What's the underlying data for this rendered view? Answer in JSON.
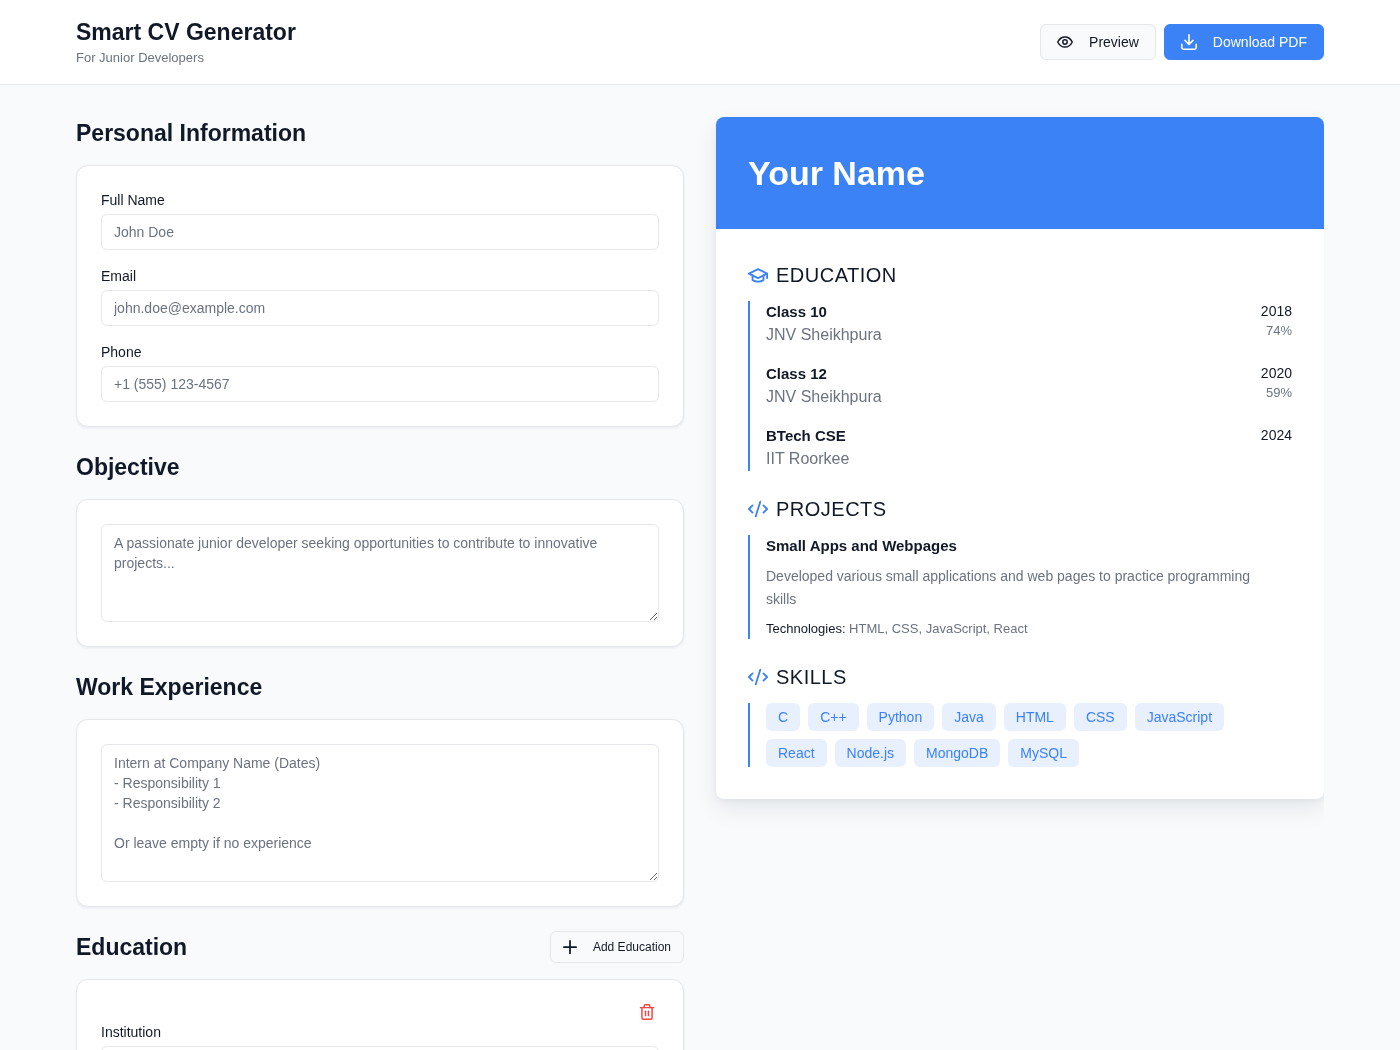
{
  "header": {
    "title": "Smart CV Generator",
    "subtitle": "For Junior Developers",
    "buttons": [
      {
        "label": "Preview",
        "kind": "preview"
      },
      {
        "label": "Download PDF",
        "kind": "download"
      }
    ]
  },
  "form": {
    "sections": [
      {
        "kind": "fields",
        "title": "Personal Information",
        "fields": [
          {
            "label": "Full Name",
            "placeholder": "John Doe"
          },
          {
            "label": "Email",
            "placeholder": "john.doe@example.com"
          },
          {
            "label": "Phone",
            "placeholder": "+1 (555) 123-4567"
          }
        ]
      },
      {
        "kind": "text",
        "title": "Objective",
        "placeholder": "A passionate junior developer seeking opportunities to contribute to innovative projects..."
      },
      {
        "kind": "text",
        "title": "Work Experience",
        "placeholder": "Intern at Company Name (Dates)\n- Responsibility 1\n- Responsibility 2\n\nOr leave empty if no experience"
      },
      {
        "kind": "entries",
        "title": "Education",
        "add_button": "Add Education",
        "entries": [
          {
            "fields": [
              {
                "label": "Institution"
              }
            ]
          }
        ]
      }
    ]
  },
  "preview": {
    "name": "Your Name",
    "sections": [
      {
        "kind": "education",
        "title": "EDUCATION",
        "items": [
          {
            "title": "Class 10",
            "institution": "JNV Sheikhpura",
            "year": "2018",
            "score": "74%"
          },
          {
            "title": "Class 12",
            "institution": "JNV Sheikhpura",
            "year": "2020",
            "score": "59%"
          },
          {
            "title": "BTech CSE",
            "institution": "IIT Roorkee",
            "year": "2024"
          }
        ]
      },
      {
        "kind": "projects",
        "title": "PROJECTS",
        "items": [
          {
            "title": "Small Apps and Webpages",
            "description": "Developed various small applications and web pages to practice programming skills",
            "technologies": "**Technologies:** HTML, CSS, JavaScript, React"
          }
        ]
      },
      {
        "kind": "skills",
        "title": "SKILLS",
        "skills": [
          "C",
          "C++",
          "Python",
          "Java",
          "HTML",
          "CSS",
          "JavaScript",
          "React",
          "Node.js",
          "MongoDB",
          "MySQL"
        ]
      }
    ]
  }
}
